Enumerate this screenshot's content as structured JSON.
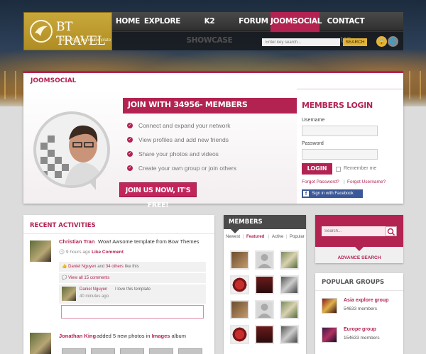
{
  "header": {
    "logo_title": "BT TRAVEL",
    "logo_subtitle": "June 2012 joomla template",
    "nav": [
      {
        "label": "HOME"
      },
      {
        "label": "EXPLORE"
      },
      {
        "label": "K2 SHOWCASE"
      },
      {
        "label": "FORUM"
      },
      {
        "label": "JOOMSOCIAL",
        "active": true
      },
      {
        "label": "CONTACT US"
      }
    ],
    "search_placeholder": "Enter key search...",
    "search_button": "SEARCH",
    "accent_color": "#b32352"
  },
  "joomsocial": {
    "title": "JOOMSOCIAL",
    "join_banner": "JOIN WITH 34956- MEMBERS",
    "features": [
      "Connect and expand your network",
      "View profiles and add new friends",
      "Share your photos and videos",
      "Create your own group or join others"
    ],
    "join_button": "JOIN US NOW, IT'S FREE!",
    "login": {
      "title": "MEMBERS LOGIN",
      "username_label": "Username",
      "password_label": "Password",
      "login_button": "LOGIN",
      "remember_label": "Remember me",
      "forgot_password": "Forgot Password?",
      "separator": "|",
      "forgot_username": "Forgot Username?",
      "facebook_button": "Sign in with Facebook"
    }
  },
  "recent": {
    "title": "RECENT ACTIVITIES",
    "activity1": {
      "name": "Christian Tran",
      "text": "Wow! Awsome template from Bow Themes",
      "time": "9 hours ago",
      "like": "Like",
      "comment": "Comment",
      "likes_user": "Daniel Nguyen",
      "likes_and": "and",
      "likes_others": "34 others",
      "likes_suffix": "like this",
      "view_all": "View all 15 comments",
      "reply_name": "Daniel Nguyen",
      "reply_text": "I love this template",
      "reply_time": "40 minutes ago"
    },
    "activity2": {
      "name": "Jonathan King",
      "text": "added 5 new photos in",
      "album_link": "Images",
      "album_suffix": "album"
    }
  },
  "members": {
    "title": "MEMBERS",
    "tabs": [
      "Newest",
      "Featured",
      "Active",
      "Popular"
    ],
    "active_tab": "Featured"
  },
  "advanced_search": {
    "placeholder": "Search...",
    "label": "ADVANCE SEARCH"
  },
  "groups": {
    "title": "POPULAR GROUPS",
    "items": [
      {
        "name": "Asia explore group",
        "count": "54633 members"
      },
      {
        "name": "Europe group",
        "count": "154633 members"
      }
    ]
  }
}
